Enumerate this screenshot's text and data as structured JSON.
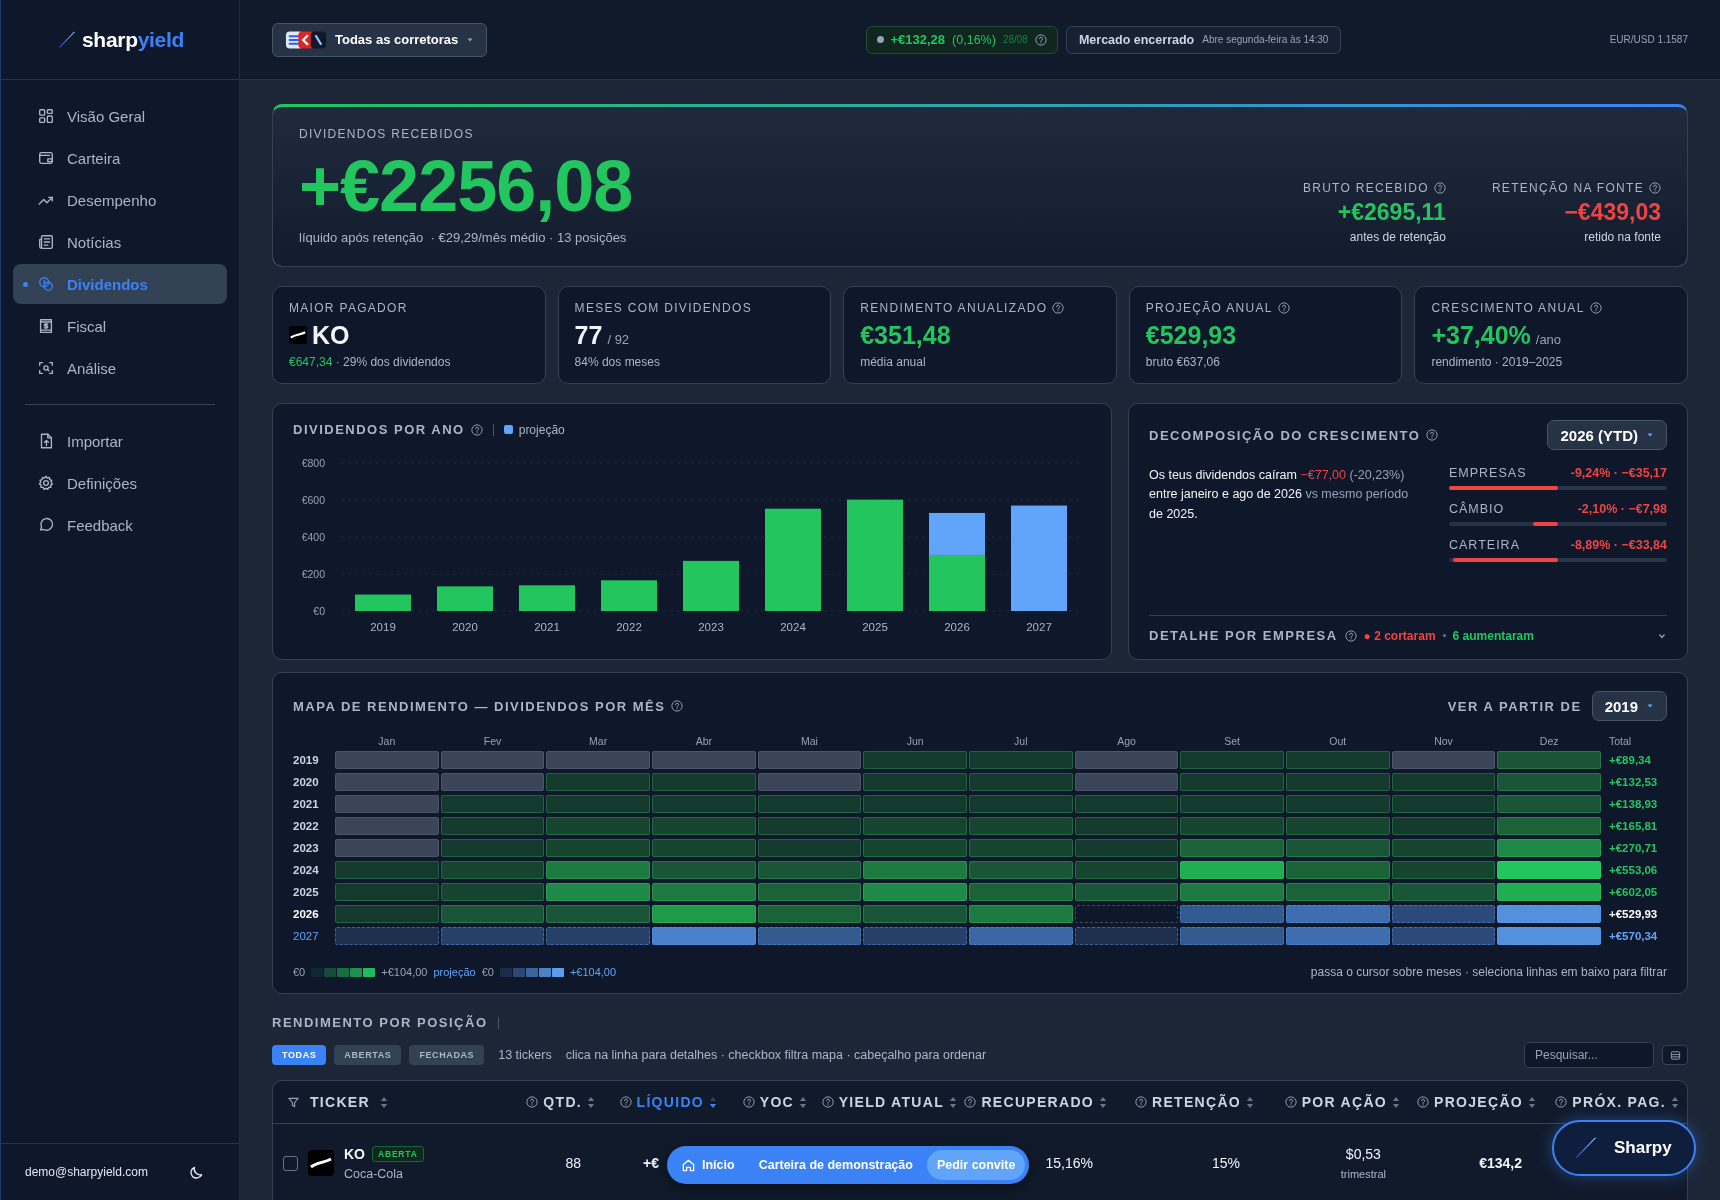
{
  "sidebar": {
    "logo": {
      "brand": "sharp",
      "brand_accent": "yield"
    },
    "nav_main": [
      {
        "label": "Visão Geral",
        "selected": false
      },
      {
        "label": "Carteira",
        "selected": false
      },
      {
        "label": "Desempenho",
        "selected": false
      },
      {
        "label": "Notícias",
        "selected": false
      },
      {
        "label": "Dividendos",
        "selected": true
      },
      {
        "label": "Fiscal",
        "selected": false
      },
      {
        "label": "Análise",
        "selected": false
      }
    ],
    "nav_secondary": [
      {
        "label": "Importar",
        "selected": false
      },
      {
        "label": "Definições",
        "selected": false
      },
      {
        "label": "Feedback",
        "selected": false
      }
    ],
    "user_email": "demo@sharpyield.com"
  },
  "topbar": {
    "broker_selector": "Todas as corretoras",
    "day_change": {
      "value": "+€132,28",
      "percent": "(0,16%)",
      "date": "28/08"
    },
    "market": {
      "status": "Mercado encerrado",
      "note": "Abre segunda-feira às 14:30"
    },
    "fx_rate": "EUR/USD 1.1587"
  },
  "hero": {
    "label": "DIVIDENDOS RECEBIDOS",
    "value": "+€2256,08",
    "sub": "líquido após retenção  · €29,29/mês médio · 13 posições",
    "stats": [
      {
        "label": "BRUTO RECEBIDO",
        "value": "+€2695,11",
        "note": "antes de retenção",
        "kind": "positive"
      },
      {
        "label": "RETENÇÃO NA FONTE",
        "value": "−€439,03",
        "note": "retido na fonte",
        "kind": "negative"
      }
    ]
  },
  "kpis": [
    {
      "label": "MAIOR PAGADOR",
      "help": false,
      "kind": "ticker",
      "value": "KO",
      "note_highlight": "€647,34",
      "note": " · 29% dos dividendos"
    },
    {
      "label": "MESES COM DIVIDENDOS",
      "help": false,
      "kind": "plain",
      "value": "77",
      "suffix": "/ 92",
      "note": "84% dos meses"
    },
    {
      "label": "RENDIMENTO ANUALIZADO",
      "help": true,
      "kind": "positive",
      "value": "€351,48",
      "note": "média anual"
    },
    {
      "label": "PROJEÇÃO ANUAL",
      "help": true,
      "kind": "positive",
      "value": "€529,93",
      "note": "bruto €637,06"
    },
    {
      "label": "CRESCIMENTO ANUAL",
      "help": true,
      "kind": "positive",
      "value": "+37,40%",
      "suffix": "/ano",
      "note": "rendimento · 2019–2025"
    }
  ],
  "yearly_chart": {
    "title": "DIVIDENDOS POR ANO",
    "chart_data": {
      "type": "bar",
      "stacked": true,
      "grid": true,
      "categories": [
        "2019",
        "2020",
        "2021",
        "2022",
        "2023",
        "2024",
        "2025",
        "2026",
        "2027"
      ],
      "series": [
        {
          "color": "#22c55e",
          "values": [
            89,
            133,
            139,
            166,
            271,
            553,
            602,
            303,
            null
          ]
        },
        {
          "name": "projeção",
          "color": "#60a5fa",
          "values": [
            null,
            null,
            null,
            null,
            null,
            null,
            null,
            227,
            570
          ]
        }
      ],
      "ylim": [
        0,
        800
      ],
      "yticks": [
        {
          "value": 0,
          "label": "€0"
        },
        {
          "value": 200,
          "label": "€200"
        },
        {
          "value": 400,
          "label": "€400"
        },
        {
          "value": 600,
          "label": "€600"
        },
        {
          "value": 800,
          "label": "€800"
        }
      ]
    }
  },
  "decomposition": {
    "title": "DECOMPOSIÇÃO DO CRESCIMENTO",
    "period": "2026 (YTD)",
    "summary": [
      {
        "text": "Os teus dividendos caíram ",
        "kind": "text"
      },
      {
        "text": "−€77,00",
        "kind": "negative"
      },
      {
        "text": " (-20,23%)",
        "kind": "muted"
      },
      {
        "text": " entre janeiro e ago de 2026",
        "kind": "text"
      },
      {
        "text": " vs mesmo período",
        "kind": "muted"
      },
      {
        "text": " de 2025.",
        "kind": "text"
      }
    ],
    "factors": [
      {
        "label": "EMPRESAS",
        "value": "-9,24% · −€35,17",
        "level": 1
      },
      {
        "label": "CÂMBIO",
        "value": "-2,10% · −€7,98",
        "level": 0.23
      },
      {
        "label": "CARTEIRA",
        "value": "-8,89% · −€33,84",
        "level": 0.96
      }
    ],
    "detail": {
      "title": "DETALHE POR EMPRESA",
      "cut": "● 2 cortaram",
      "raised": "6 aumentaram",
      "expanded": false
    }
  },
  "heatmap": {
    "title": "MAPA DE RENDIMENTO — DIVIDENDOS POR MÊS",
    "from_label": "VER A PARTIR DE",
    "from_year": "2019",
    "months": [
      "Jan",
      "Fev",
      "Mar",
      "Abr",
      "Mai",
      "Jun",
      "Jul",
      "Ago",
      "Set",
      "Out",
      "Nov",
      "Dez"
    ],
    "total_label": "Total",
    "rows": [
      {
        "year": "2019",
        "total": "+€89,34",
        "kind": "past",
        "cells": [
          {
            "kind": "none"
          },
          {
            "kind": "none"
          },
          {
            "kind": "none"
          },
          {
            "kind": "none"
          },
          {
            "kind": "none"
          },
          {
            "kind": "paid",
            "color": "#133a2c"
          },
          {
            "kind": "paid",
            "color": "#133a2c"
          },
          {
            "kind": "none"
          },
          {
            "kind": "paid",
            "color": "#133a2c"
          },
          {
            "kind": "paid",
            "color": "#133a2c"
          },
          {
            "kind": "none"
          },
          {
            "kind": "paid",
            "color": "#1a5537"
          }
        ]
      },
      {
        "year": "2020",
        "total": "+€132,53",
        "kind": "past",
        "cells": [
          {
            "kind": "none"
          },
          {
            "kind": "none"
          },
          {
            "kind": "paid",
            "color": "#133a2c"
          },
          {
            "kind": "paid",
            "color": "#133a2c"
          },
          {
            "kind": "none"
          },
          {
            "kind": "paid",
            "color": "#133a2c"
          },
          {
            "kind": "paid",
            "color": "#133a2c"
          },
          {
            "kind": "none"
          },
          {
            "kind": "paid",
            "color": "#133a2c"
          },
          {
            "kind": "paid",
            "color": "#133a2c"
          },
          {
            "kind": "paid",
            "color": "#133a2c"
          },
          {
            "kind": "paid",
            "color": "#1a5537"
          }
        ]
      },
      {
        "year": "2021",
        "total": "+€138,93",
        "kind": "past",
        "cells": [
          {
            "kind": "none"
          },
          {
            "kind": "paid",
            "color": "#133a2c"
          },
          {
            "kind": "paid",
            "color": "#133a2c"
          },
          {
            "kind": "paid",
            "color": "#133a2c"
          },
          {
            "kind": "paid",
            "color": "#133a2c"
          },
          {
            "kind": "paid",
            "color": "#133a2c"
          },
          {
            "kind": "paid",
            "color": "#133a2c"
          },
          {
            "kind": "paid",
            "color": "#133a2c"
          },
          {
            "kind": "paid",
            "color": "#133a2c"
          },
          {
            "kind": "paid",
            "color": "#133a2c"
          },
          {
            "kind": "paid",
            "color": "#133a2c"
          },
          {
            "kind": "paid",
            "color": "#1a5537"
          }
        ]
      },
      {
        "year": "2022",
        "total": "+€165,81",
        "kind": "past",
        "cells": [
          {
            "kind": "none"
          },
          {
            "kind": "paid",
            "color": "#133a2c"
          },
          {
            "kind": "paid",
            "color": "#16452f"
          },
          {
            "kind": "paid",
            "color": "#16452f"
          },
          {
            "kind": "paid",
            "color": "#133a2c"
          },
          {
            "kind": "paid",
            "color": "#16452f"
          },
          {
            "kind": "paid",
            "color": "#16452f"
          },
          {
            "kind": "paid",
            "color": "#133a2c"
          },
          {
            "kind": "paid",
            "color": "#16452f"
          },
          {
            "kind": "paid",
            "color": "#16452f"
          },
          {
            "kind": "paid",
            "color": "#133a2c"
          },
          {
            "kind": "paid",
            "color": "#1b6238"
          }
        ]
      },
      {
        "year": "2023",
        "total": "+€270,71",
        "kind": "past",
        "cells": [
          {
            "kind": "none"
          },
          {
            "kind": "paid",
            "color": "#133a2c"
          },
          {
            "kind": "paid",
            "color": "#16452f"
          },
          {
            "kind": "paid",
            "color": "#16452f"
          },
          {
            "kind": "paid",
            "color": "#133a2c"
          },
          {
            "kind": "paid",
            "color": "#16452f"
          },
          {
            "kind": "paid",
            "color": "#16452f"
          },
          {
            "kind": "paid",
            "color": "#133a2c"
          },
          {
            "kind": "paid",
            "color": "#1b6238"
          },
          {
            "kind": "paid",
            "color": "#1a5537"
          },
          {
            "kind": "paid",
            "color": "#16452f"
          },
          {
            "kind": "paid",
            "color": "#1f8a47"
          }
        ]
      },
      {
        "year": "2024",
        "total": "+€553,06",
        "kind": "past",
        "cells": [
          {
            "kind": "paid",
            "color": "#133a2c"
          },
          {
            "kind": "paid",
            "color": "#16452f"
          },
          {
            "kind": "paid",
            "color": "#1d7a41"
          },
          {
            "kind": "paid",
            "color": "#1a5537"
          },
          {
            "kind": "paid",
            "color": "#1a5537"
          },
          {
            "kind": "paid",
            "color": "#1d7a41"
          },
          {
            "kind": "paid",
            "color": "#1a5537"
          },
          {
            "kind": "paid",
            "color": "#16452f"
          },
          {
            "kind": "paid",
            "color": "#21ad51"
          },
          {
            "kind": "paid",
            "color": "#1b6238"
          },
          {
            "kind": "paid",
            "color": "#16452f"
          },
          {
            "kind": "paid",
            "color": "#22c55e"
          }
        ]
      },
      {
        "year": "2025",
        "total": "+€602,05",
        "kind": "past",
        "cells": [
          {
            "kind": "paid",
            "color": "#133a2c"
          },
          {
            "kind": "paid",
            "color": "#16452f"
          },
          {
            "kind": "paid",
            "color": "#1f8a47"
          },
          {
            "kind": "paid",
            "color": "#1d7a41"
          },
          {
            "kind": "paid",
            "color": "#1b6238"
          },
          {
            "kind": "paid",
            "color": "#1f8a47"
          },
          {
            "kind": "paid",
            "color": "#1b6238"
          },
          {
            "kind": "paid",
            "color": "#1a5537"
          },
          {
            "kind": "paid",
            "color": "#1d7a41"
          },
          {
            "kind": "paid",
            "color": "#1b6238"
          },
          {
            "kind": "paid",
            "color": "#1a5537"
          },
          {
            "kind": "paid",
            "color": "#21ad51"
          }
        ]
      },
      {
        "year": "2026",
        "total": "+€529,93",
        "kind": "current",
        "cells": [
          {
            "kind": "paid",
            "color": "#133a2c"
          },
          {
            "kind": "paid",
            "color": "#1a5537"
          },
          {
            "kind": "paid",
            "color": "#1a5537"
          },
          {
            "kind": "paid",
            "color": "#1f9a4b"
          },
          {
            "kind": "paid",
            "color": "#1b6238"
          },
          {
            "kind": "paid",
            "color": "#1a5537"
          },
          {
            "kind": "paid",
            "color": "#1d7a41"
          },
          {
            "kind": "pending"
          },
          {
            "kind": "projected",
            "color": "#335a8f"
          },
          {
            "kind": "projected",
            "color": "#3e6db0"
          },
          {
            "kind": "projected",
            "color": "#2b4a7a"
          },
          {
            "kind": "projected",
            "color": "#5590dd"
          }
        ]
      },
      {
        "year": "2027",
        "total": "+€570,34",
        "kind": "projection",
        "cells": [
          {
            "kind": "projected",
            "color": "#1e2f4d"
          },
          {
            "kind": "projected",
            "color": "#26406a"
          },
          {
            "kind": "projected",
            "color": "#26406a"
          },
          {
            "kind": "projected",
            "color": "#4a80cc"
          },
          {
            "kind": "projected",
            "color": "#335a8f"
          },
          {
            "kind": "projected",
            "color": "#26406a"
          },
          {
            "kind": "projected",
            "color": "#3a66a3"
          },
          {
            "kind": "projected",
            "color": "#1e2f4d"
          },
          {
            "kind": "projected",
            "color": "#335a8f"
          },
          {
            "kind": "projected",
            "color": "#3e6db0"
          },
          {
            "kind": "projected",
            "color": "#2b4a7a"
          },
          {
            "kind": "projected",
            "color": "#5590dd"
          }
        ]
      }
    ],
    "legend": {
      "min": "€0",
      "max": "+€104,00",
      "projection_label": "projeção",
      "projection_min": "€0",
      "projection_max": "+€104,00"
    },
    "hint": "passa o cursor sobre meses · seleciona linhas em baixo para filtrar"
  },
  "positions": {
    "title": "RENDIMENTO POR POSIÇÃO",
    "filters": [
      {
        "label": "TODAS",
        "selected": true
      },
      {
        "label": "ABERTAS",
        "selected": false
      },
      {
        "label": "FECHADAS",
        "selected": false
      }
    ],
    "count": "13 tickers",
    "hint": "clica na linha para detalhes · checkbox filtra mapa · cabeçalho para ordenar",
    "search": {
      "placeholder": "Pesquisar..."
    },
    "columns": [
      {
        "label": "TICKER",
        "help": false,
        "sorted": false
      },
      {
        "label": "QTD.",
        "help": true,
        "sorted": false
      },
      {
        "label": "LÍQUIDO",
        "help": true,
        "sorted": true
      },
      {
        "label": "YOC",
        "help": true,
        "sorted": false
      },
      {
        "label": "YIELD ATUAL",
        "help": true,
        "sorted": false
      },
      {
        "label": "RECUPERADO",
        "help": true,
        "sorted": false
      },
      {
        "label": "RETENÇÃO",
        "help": true,
        "sorted": false
      },
      {
        "label": "POR AÇÃO",
        "help": true,
        "sorted": false
      },
      {
        "label": "PROJEÇÃO",
        "help": true,
        "sorted": false
      },
      {
        "label": "PRÓX. PAG.",
        "help": true,
        "sorted": false
      }
    ],
    "rows": [
      {
        "checked": false,
        "ticker": "KO",
        "status": "ABERTA",
        "name": "Coca-Cola",
        "quantity": "88",
        "net": "+€",
        "recovered": "15,16%",
        "withholding": "15%",
        "per_share": "$0,53",
        "frequency": "trimestral",
        "projection": "€134,2"
      }
    ]
  },
  "floating_nav": {
    "items": [
      {
        "label": "Início",
        "kind": "home"
      },
      {
        "label": "Carteira de demonstração",
        "kind": "link"
      },
      {
        "label": "Pedir convite",
        "kind": "cta"
      }
    ]
  },
  "assistant_button": "Sharpy"
}
